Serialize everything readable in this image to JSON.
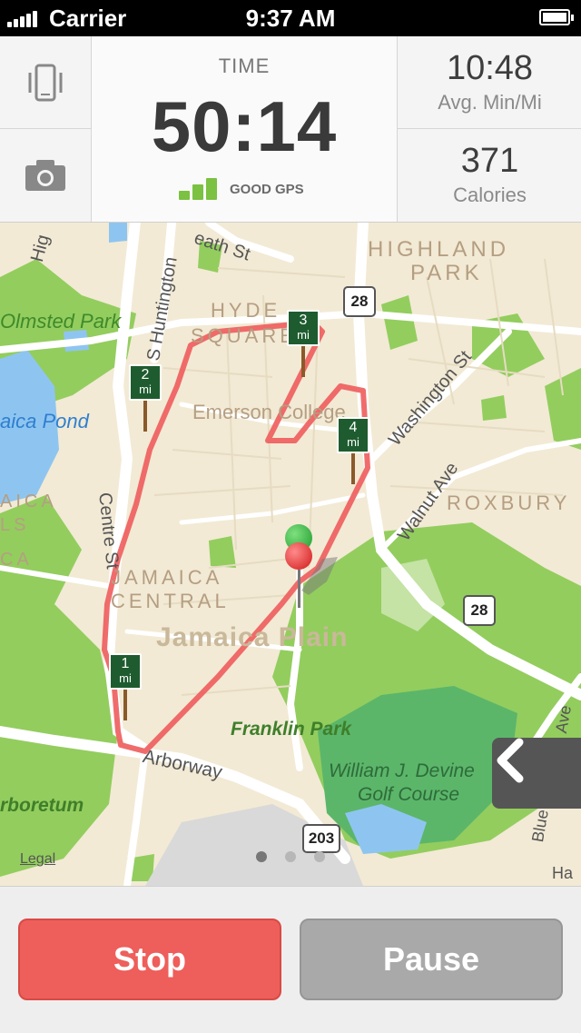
{
  "status_bar": {
    "carrier": "Carrier",
    "time": "9:37 AM"
  },
  "stats": {
    "time_label": "TIME",
    "time_value": "50:14",
    "gps_status": "GOOD GPS",
    "pace_value": "10:48",
    "pace_label": "Avg. Min/Mi",
    "calories_value": "371",
    "calories_label": "Calories"
  },
  "map": {
    "labels": {
      "highland": "HIGHLAND",
      "park": "PARK",
      "hyde": "HYDE",
      "square": "SQUARE",
      "olmsted_park": "Olmsted Park",
      "jamaica_pond": "aica Pond",
      "emerson_college": "Emerson College",
      "roxbury": "ROXBURY",
      "jamaica_central_1": "JAMAICA",
      "jamaica_central_2": "CENTRAL",
      "jamaica_plain": "Jamaica Plain",
      "franklin_park": "Franklin Park",
      "golf_course_1": "William J. Devine",
      "golf_course_2": "Golf Course",
      "arboretum": "rboretum",
      "arborway": "Arborway",
      "centre_st": "Centre St",
      "s_huntington": "S Huntington",
      "heath_st": "eath St",
      "washington_st": "Washington St",
      "walnut_ave": "Walnut Ave",
      "jamaica_left_1": "AICA",
      "jamaica_left_2": "LS",
      "left_ca": "CA",
      "hi_top": "Hig",
      "seaver": "Ha",
      "blue_hill": "Blue",
      "ave_right": "Ave"
    },
    "routes": {
      "r28_top": "28",
      "r28_mid": "28",
      "r203": "203"
    },
    "mile_markers": [
      {
        "num": "1",
        "unit": "mi"
      },
      {
        "num": "2",
        "unit": "mi"
      },
      {
        "num": "3",
        "unit": "mi"
      },
      {
        "num": "4",
        "unit": "mi"
      }
    ],
    "legal": "Legal",
    "side_tab_icon": "chevron-left-icon"
  },
  "buttons": {
    "stop": "Stop",
    "pause": "Pause"
  },
  "colors": {
    "route": "#ee5c5c",
    "stop": "#ee5e5a",
    "pause": "#a9a9a9",
    "gps_good": "#7bc142",
    "park_green": "#8fcb5a"
  }
}
